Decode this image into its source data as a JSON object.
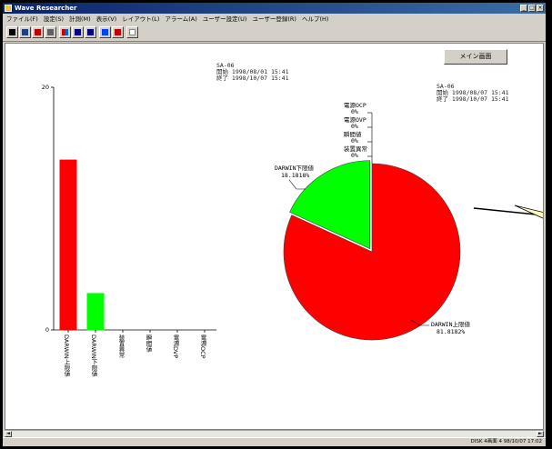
{
  "window": {
    "title": "Wave Researcher",
    "menus": [
      "ファイル(F)",
      "設定(S)",
      "計測(M)",
      "表示(V)",
      "レイアウト(L)",
      "アラーム(A)",
      "ユーザー設定(U)",
      "ユーザー登録(R)",
      "ヘルプ(H)"
    ]
  },
  "toolbar": {
    "icons": [
      "play-icon",
      "stop-icon",
      "record-icon",
      "print-icon",
      "chart-icon",
      "prev-icon",
      "next-icon",
      "zoom-icon",
      "graph-icon",
      "help-icon"
    ]
  },
  "main_screen_button": "メイン画面",
  "bar_info": {
    "line1": "SA-06",
    "line2": "開始 1998/08/01 15:41",
    "line3": "終了 1998/10/07 15:41"
  },
  "pie_info": {
    "line1": "SA-06",
    "line2": "開始 1998/08/07 15:41",
    "line3": "終了 1998/10/07 15:41"
  },
  "status_text": "DISK 4画面 4 98/10/07 17:02",
  "colors": {
    "red": "#ff0000",
    "green": "#00ff00"
  },
  "chart_data": [
    {
      "type": "bar",
      "categories": [
        "DARWIN上限値",
        "DARWIN下限値",
        "装置異常",
        "瞬間値",
        "電源DVP",
        "電源OCP"
      ],
      "values": [
        14,
        3,
        0,
        0,
        0,
        0
      ],
      "colors": [
        "#ff0000",
        "#00ff00",
        "#ff0000",
        "#ff0000",
        "#ff0000",
        "#ff0000"
      ],
      "ylim": [
        0,
        20
      ],
      "yticks": [
        "20",
        "0"
      ]
    },
    {
      "type": "pie",
      "slices": [
        {
          "label": "DARWIN上限値",
          "percent_text": "81.8182%",
          "value": 81.8182,
          "color": "#ff0000"
        },
        {
          "label": "DARWIN下限値",
          "percent_text": "18.1818%",
          "value": 18.1818,
          "color": "#00ff00",
          "exploded": true
        }
      ],
      "zero_labels": [
        {
          "label": "電源OCP",
          "percent_text": "0%"
        },
        {
          "label": "電源OVP",
          "percent_text": "0%"
        },
        {
          "label": "瞬間値",
          "percent_text": "0%"
        },
        {
          "label": "装置異常",
          "percent_text": "0%"
        }
      ]
    }
  ]
}
